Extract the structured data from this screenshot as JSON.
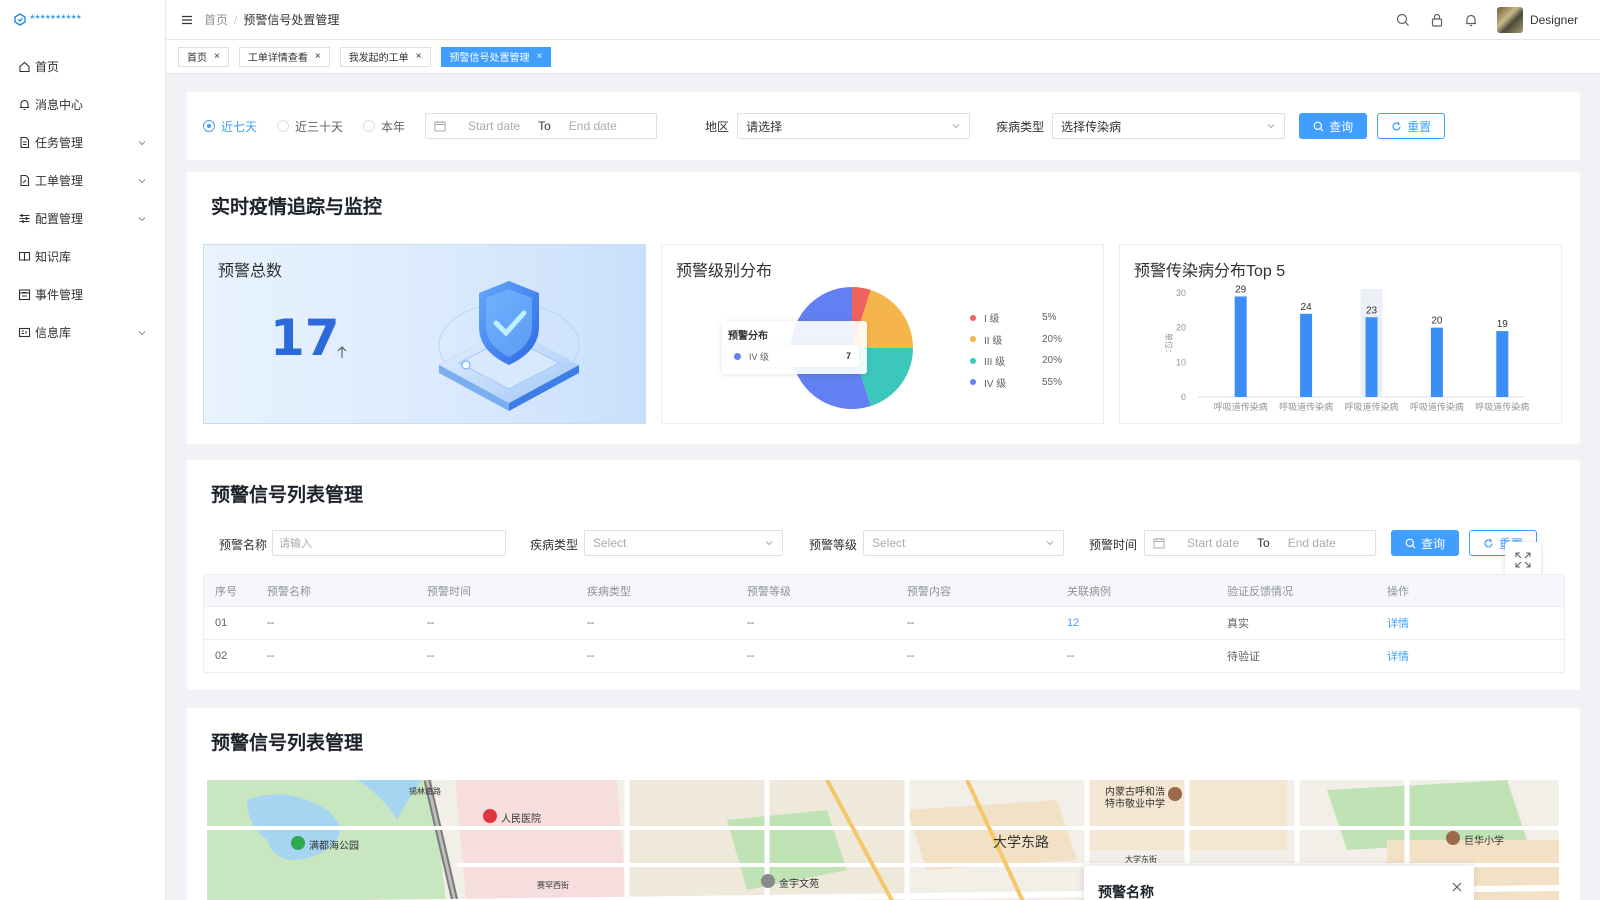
{
  "app": {
    "logo_text": "**********"
  },
  "sidebar": {
    "items": [
      {
        "label": "首页",
        "icon": "home-icon",
        "expandable": false
      },
      {
        "label": "消息中心",
        "icon": "bell-icon",
        "expandable": false
      },
      {
        "label": "任务管理",
        "icon": "document-icon",
        "expandable": true
      },
      {
        "label": "工单管理",
        "icon": "file-edit-icon",
        "expandable": true
      },
      {
        "label": "配置管理",
        "icon": "sliders-icon",
        "expandable": true
      },
      {
        "label": "知识库",
        "icon": "book-icon",
        "expandable": false
      },
      {
        "label": "事件管理",
        "icon": "calendar-icon",
        "expandable": false
      },
      {
        "label": "信息库",
        "icon": "id-card-icon",
        "expandable": true
      }
    ]
  },
  "header": {
    "breadcrumb": [
      "首页",
      "预警信号处置管理"
    ],
    "user_name": "Designer"
  },
  "tabs": [
    {
      "label": "首页",
      "active": false
    },
    {
      "label": "工单详情查看",
      "active": false
    },
    {
      "label": "我发起的工单",
      "active": false
    },
    {
      "label": "预警信号处置管理",
      "active": true
    }
  ],
  "filter": {
    "ranges": [
      {
        "label": "近七天",
        "selected": true
      },
      {
        "label": "近三十天",
        "selected": false
      },
      {
        "label": "本年",
        "selected": false
      }
    ],
    "date_start_placeholder": "Start date",
    "date_to": "To",
    "date_end_placeholder": "End date",
    "region_label": "地区",
    "region_value": "请选择",
    "disease_label": "疾病类型",
    "disease_value": "选择传染病",
    "query_label": "查询",
    "reset_label": "重置"
  },
  "monitor": {
    "title": "实时疫情追踪与监控",
    "total_title": "预警总数",
    "total_value": "17",
    "level_title": "预警级别分布",
    "top5_title": "预警传染病分布Top 5"
  },
  "chart_data": [
    {
      "type": "pie",
      "title": "预警级别分布",
      "categories": [
        "I 级",
        "II 级",
        "III 级",
        "IV 级"
      ],
      "values": [
        5,
        20,
        20,
        55
      ],
      "value_labels": [
        "5%",
        "20%",
        "20%",
        "55%"
      ],
      "colors": [
        "#f0625c",
        "#f5b54a",
        "#3cc7bd",
        "#6280f2"
      ],
      "legend": "right",
      "tooltip": {
        "title": "预警分布",
        "label": "IV 级",
        "value": "7"
      }
    },
    {
      "type": "bar",
      "title": "预警传染病分布Top 5",
      "ylabel": "单位：",
      "categories": [
        "呼吸道传染病",
        "呼吸道传染病",
        "呼吸道传染病",
        "呼吸道传染病",
        "呼吸道传染病"
      ],
      "values": [
        29,
        24,
        23,
        20,
        19
      ],
      "ylim": [
        0,
        30
      ],
      "yticks": [
        0,
        10,
        20,
        30
      ],
      "highlighted_index": 2,
      "grid": false,
      "color": "#3a8ef6"
    }
  ],
  "list": {
    "title": "预警信号列表管理",
    "name_label": "预警名称",
    "name_placeholder": "请输入",
    "disease_label": "疾病类型",
    "disease_placeholder": "Select",
    "level_label": "预警等级",
    "level_placeholder": "Select",
    "time_label": "预警时间",
    "date_start_placeholder": "Start date",
    "date_to": "To",
    "date_end_placeholder": "End date",
    "query_label": "查询",
    "reset_label": "重置",
    "columns": [
      "序号",
      "预警名称",
      "预警时间",
      "疾病类型",
      "预警等级",
      "预警内容",
      "关联病例",
      "验证反馈情况",
      "操作"
    ],
    "rows": [
      [
        "01",
        "--",
        "--",
        "--",
        "--",
        "--",
        "12",
        "真实",
        "详情"
      ],
      [
        "02",
        "--",
        "--",
        "--",
        "--",
        "--",
        "--",
        "待验证",
        "详情"
      ]
    ]
  },
  "map_section": {
    "title": "预警信号列表管理",
    "labels": [
      "人民医院",
      "满都海公园",
      "大学东路",
      "内蒙古呼和浩",
      "特市敬业中学",
      "巨华小学",
      "金宇文苑",
      "大学东街",
      "锡林南路",
      "赛罕西街"
    ],
    "popup_title": "预警名称"
  },
  "colors": {
    "primary": "#409eff",
    "chart_blue": "#3a8ef6"
  }
}
